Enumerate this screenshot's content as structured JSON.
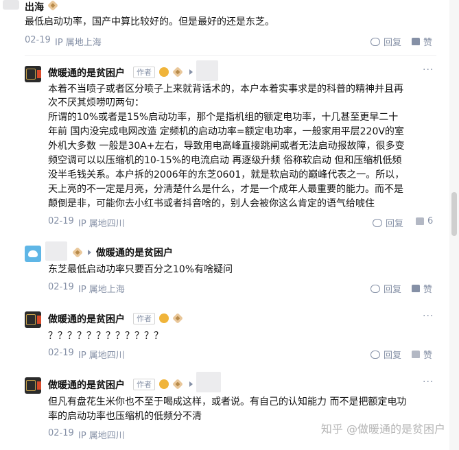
{
  "comments": [
    {
      "name": "出海",
      "text_lines": [
        "最低启动功率，国产中算比较好的。但是最好的还是东芝。"
      ],
      "date": "02-19",
      "location": "IP 属地上海",
      "reply_label": "回复",
      "like_label": "赞"
    },
    {
      "name": "做暖通的是贫困户",
      "author_tag": "作者",
      "text_lines": [
        "本着不当喷子或者区分喷子上来就背话术的，本户本着实事求是的科普的精神并且再",
        "次不厌其烦唠叨两句：",
        "所谓的10%或者是15%启动功率，那个是指机组的额定电功率，十几甚至更早二十",
        "年前 国内没完成电网改造 定频机的启动功率=额定电功率，一般家用平层220V的室",
        "外机大多数 一般是30A+左右，导致用电高峰直接跳闸或者无法启动报故障，很多变",
        "频空调可以以压缩机的10-15%的电流启动 再逐级升频 俗称软启动 但和压缩机低频",
        "没半毛钱关系。本户拆的2006年的东芝0601，就是软启动的巅峰代表之一。所以，",
        "天上亮的不一定是月亮，分清楚什么是什么，才是一个成年人最重要的能力。而不是",
        "颠倒是非，可能你去小红书或者抖音啥的，别人会被你这么肯定的语气给唬住"
      ],
      "date": "02-19",
      "location": "IP 属地四川",
      "reply_label": "回复",
      "like_count": "6"
    },
    {
      "reply_to": "做暖通的是贫困户",
      "text_lines": [
        "东芝最低启动功率只要百分之10%有啥疑问"
      ],
      "date": "02-19",
      "location": "IP 属地上海",
      "reply_label": "回复",
      "like_label": "赞"
    },
    {
      "name": "做暖通的是贫困户",
      "author_tag": "作者",
      "text_lines": [
        "？？？？？？？？？？？？"
      ],
      "date": "02-19",
      "location": "IP 属地四川",
      "reply_label": "回复",
      "like_label": "赞"
    },
    {
      "name": "做暖通的是贫困户",
      "author_tag": "作者",
      "text_lines": [
        "但凡有盘花生米你也不至于喝成这样，或者说。有自己的认知能力 而不是把额定电功",
        "率的启动功率也压缩机的低频分不清"
      ],
      "date": "02-19",
      "location": "IP 属地四川"
    }
  ],
  "watermark": "知乎 @做暖通的是贫困户",
  "more_glyph": "···",
  "colors": {
    "meta": "#8590a6",
    "text": "#121212",
    "badge_gold": "#f0b43a"
  }
}
